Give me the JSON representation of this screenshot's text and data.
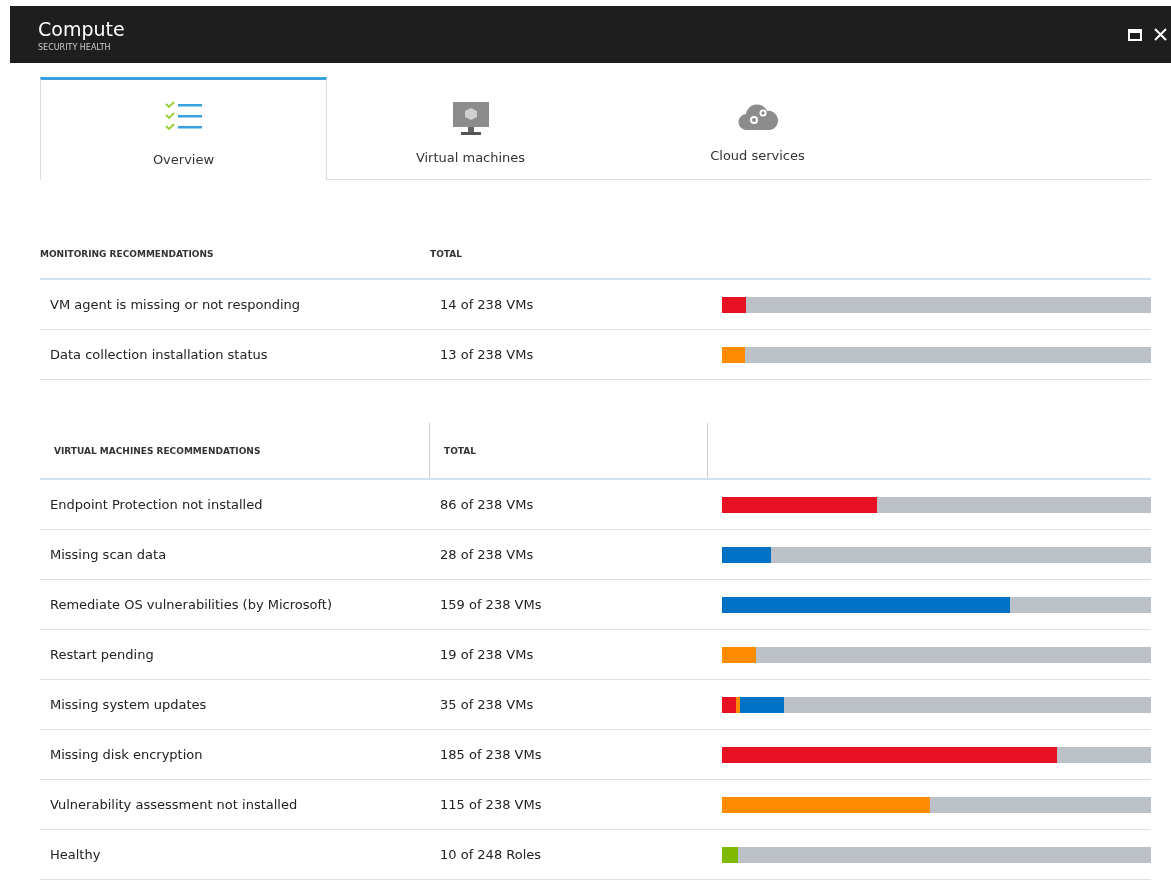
{
  "window": {
    "title": "Compute",
    "subtitle": "SECURITY HEALTH"
  },
  "tabs": [
    {
      "label": "Overview",
      "kind": "checklist",
      "selected": true
    },
    {
      "label": "Virtual machines",
      "kind": "monitor",
      "selected": false
    },
    {
      "label": "Cloud services",
      "kind": "cloud",
      "selected": false
    }
  ],
  "sections": [
    {
      "columns": [
        "MONITORING RECOMMENDATIONS",
        "TOTAL"
      ],
      "column_dividers": false,
      "rows": [
        {
          "name": "VM agent is missing or not responding",
          "total": "14 of 238 VMs",
          "segments": [
            {
              "color": "#e81123",
              "level": 0.056
            }
          ]
        },
        {
          "name": "Data collection installation status",
          "total": "13 of 238 VMs",
          "segments": [
            {
              "color": "#ff8c00",
              "level": 0.054
            }
          ]
        }
      ]
    },
    {
      "columns": [
        "VIRTUAL MACHINES RECOMMENDATIONS",
        "TOTAL"
      ],
      "column_dividers": true,
      "rows": [
        {
          "name": "Endpoint Protection not installed",
          "total": "86 of 238 VMs",
          "segments": [
            {
              "color": "#e81123",
              "level": 0.361
            }
          ]
        },
        {
          "name": "Missing scan data",
          "total": "28 of 238 VMs",
          "segments": [
            {
              "color": "#0072c6",
              "level": 0.114
            }
          ]
        },
        {
          "name": "Remediate OS vulnerabilities (by Microsoft)",
          "total": "159 of 238 VMs",
          "segments": [
            {
              "color": "#0072c6",
              "level": 0.671
            }
          ]
        },
        {
          "name": "Restart pending",
          "total": "19 of 238 VMs",
          "segments": [
            {
              "color": "#ff8c00",
              "level": 0.079
            }
          ]
        },
        {
          "name": "Missing system updates",
          "total": "35 of 238 VMs",
          "segments": [
            {
              "color": "#e81123",
              "level": 0.033
            },
            {
              "color": "#ff8c00",
              "level": 0.008
            },
            {
              "color": "#0072c6",
              "level": 0.104
            }
          ]
        },
        {
          "name": "Missing disk encryption",
          "total": "185 of 238 VMs",
          "segments": [
            {
              "color": "#e81123",
              "level": 0.781
            }
          ]
        },
        {
          "name": "Vulnerability assessment not installed",
          "total": "115 of 238 VMs",
          "segments": [
            {
              "color": "#ff8c00",
              "level": 0.485
            }
          ]
        },
        {
          "name": "Healthy",
          "total": "10 of 248 Roles",
          "segments": [
            {
              "color": "#7fba00",
              "level": 0.037
            }
          ]
        }
      ]
    }
  ]
}
